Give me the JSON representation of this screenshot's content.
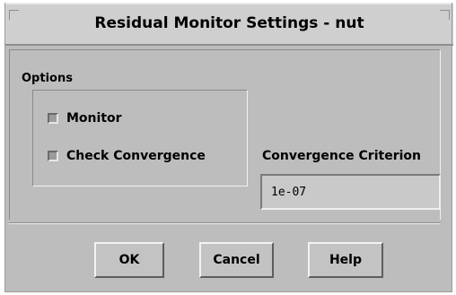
{
  "window": {
    "title": "Residual Monitor Settings - nut"
  },
  "options": {
    "label": "Options",
    "monitor": {
      "label": "Monitor",
      "checked": true
    },
    "check_convergence": {
      "label": "Check Convergence",
      "checked": true
    }
  },
  "convergence": {
    "label": "Convergence Criterion",
    "value": "1e-07"
  },
  "buttons": {
    "ok": "OK",
    "cancel": "Cancel",
    "help": "Help"
  }
}
